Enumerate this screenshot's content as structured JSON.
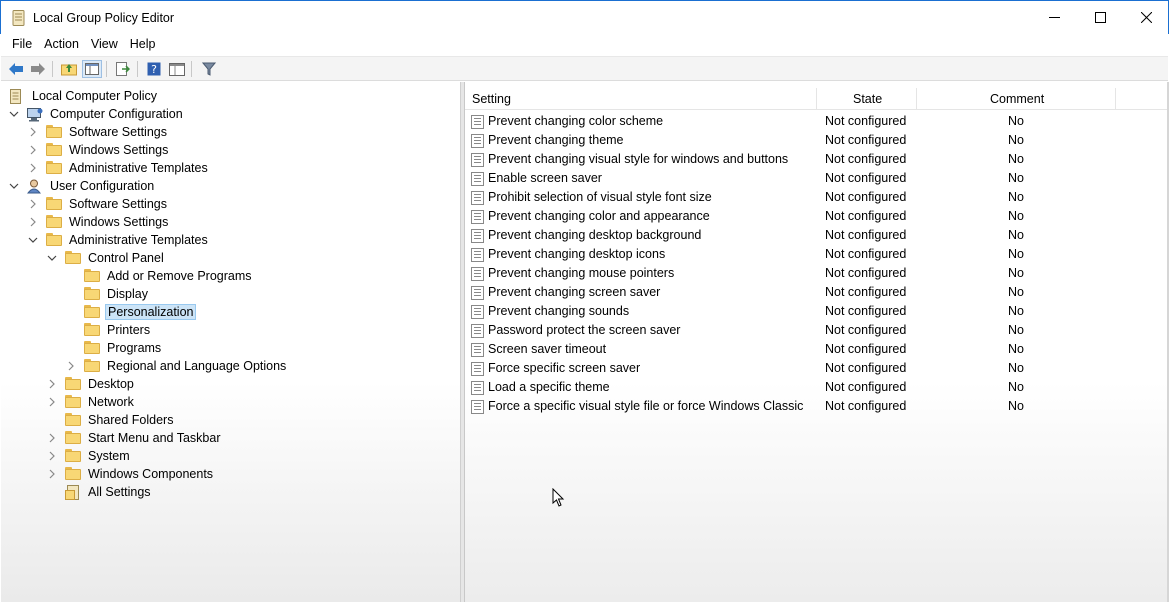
{
  "window": {
    "title": "Local Group Policy Editor"
  },
  "menu": [
    "File",
    "Action",
    "View",
    "Help"
  ],
  "tree": [
    {
      "label": "Local Computer Policy",
      "level": 0,
      "expander": "none",
      "icon": "policy-icon"
    },
    {
      "label": "Computer Configuration",
      "level": 1,
      "expander": "expanded",
      "icon": "computer-icon"
    },
    {
      "label": "Software Settings",
      "level": 2,
      "expander": "collapsed",
      "icon": "folder-icon"
    },
    {
      "label": "Windows Settings",
      "level": 2,
      "expander": "collapsed",
      "icon": "folder-icon"
    },
    {
      "label": "Administrative Templates",
      "level": 2,
      "expander": "collapsed",
      "icon": "folder-icon"
    },
    {
      "label": "User Configuration",
      "level": 1,
      "expander": "expanded",
      "icon": "user-icon"
    },
    {
      "label": "Software Settings",
      "level": 2,
      "expander": "collapsed",
      "icon": "folder-icon"
    },
    {
      "label": "Windows Settings",
      "level": 2,
      "expander": "collapsed",
      "icon": "folder-icon"
    },
    {
      "label": "Administrative Templates",
      "level": 2,
      "expander": "expanded",
      "icon": "folder-icon"
    },
    {
      "label": "Control Panel",
      "level": 3,
      "expander": "expanded",
      "icon": "folder-icon"
    },
    {
      "label": "Add or Remove Programs",
      "level": 4,
      "expander": "none",
      "icon": "folder-icon"
    },
    {
      "label": "Display",
      "level": 4,
      "expander": "none",
      "icon": "folder-icon"
    },
    {
      "label": "Personalization",
      "level": 4,
      "expander": "none",
      "icon": "folder-icon",
      "selected": true
    },
    {
      "label": "Printers",
      "level": 4,
      "expander": "none",
      "icon": "folder-icon"
    },
    {
      "label": "Programs",
      "level": 4,
      "expander": "none",
      "icon": "folder-icon"
    },
    {
      "label": "Regional and Language Options",
      "level": 4,
      "expander": "collapsed",
      "icon": "folder-icon"
    },
    {
      "label": "Desktop",
      "level": 3,
      "expander": "collapsed",
      "icon": "folder-icon"
    },
    {
      "label": "Network",
      "level": 3,
      "expander": "collapsed",
      "icon": "folder-icon"
    },
    {
      "label": "Shared Folders",
      "level": 3,
      "expander": "none",
      "icon": "folder-icon"
    },
    {
      "label": "Start Menu and Taskbar",
      "level": 3,
      "expander": "collapsed",
      "icon": "folder-icon"
    },
    {
      "label": "System",
      "level": 3,
      "expander": "collapsed",
      "icon": "folder-icon"
    },
    {
      "label": "Windows Components",
      "level": 3,
      "expander": "collapsed",
      "icon": "folder-icon"
    },
    {
      "label": "All Settings",
      "level": 3,
      "expander": "none",
      "icon": "all-settings-icon"
    }
  ],
  "list": {
    "columns": [
      "Setting",
      "State",
      "Comment"
    ],
    "rows": [
      [
        "Prevent changing color scheme",
        "Not configured",
        "No"
      ],
      [
        "Prevent changing theme",
        "Not configured",
        "No"
      ],
      [
        "Prevent changing visual style for windows and buttons",
        "Not configured",
        "No"
      ],
      [
        "Enable screen saver",
        "Not configured",
        "No"
      ],
      [
        "Prohibit selection of visual style font size",
        "Not configured",
        "No"
      ],
      [
        "Prevent changing color and appearance",
        "Not configured",
        "No"
      ],
      [
        "Prevent changing desktop background",
        "Not configured",
        "No"
      ],
      [
        "Prevent changing desktop icons",
        "Not configured",
        "No"
      ],
      [
        "Prevent changing mouse pointers",
        "Not configured",
        "No"
      ],
      [
        "Prevent changing screen saver",
        "Not configured",
        "No"
      ],
      [
        "Prevent changing sounds",
        "Not configured",
        "No"
      ],
      [
        "Password protect the screen saver",
        "Not configured",
        "No"
      ],
      [
        "Screen saver timeout",
        "Not configured",
        "No"
      ],
      [
        "Force specific screen saver",
        "Not configured",
        "No"
      ],
      [
        "Load a specific theme",
        "Not configured",
        "No"
      ],
      [
        "Force a specific visual style file or force Windows Classic",
        "Not configured",
        "No"
      ]
    ]
  },
  "colors": {
    "accent": "#1a6fd1",
    "selection": "#cce4f7",
    "folder": "#f8d775"
  }
}
